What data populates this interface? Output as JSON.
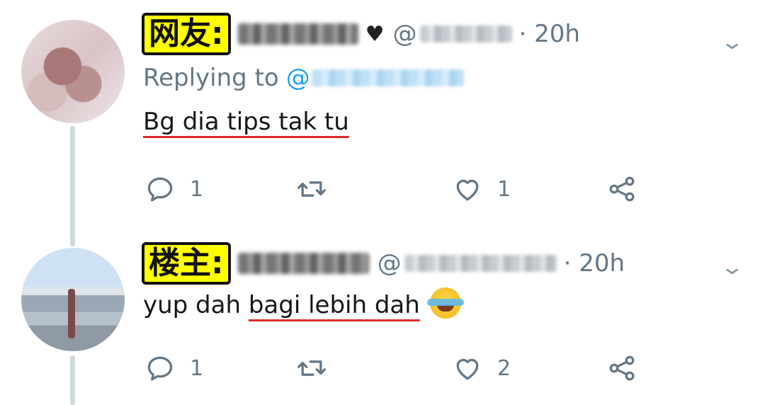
{
  "tweets": [
    {
      "tag": "网友:",
      "handle_prefix": "@",
      "time": "20h",
      "replying_label": "Replying to",
      "replying_at": "@",
      "text": "Bg dia tips tak tu",
      "reply_count": "1",
      "retweet_count": "",
      "like_count": "1"
    },
    {
      "tag": "楼主:",
      "handle_prefix": "@",
      "time": "20h",
      "text_plain": "yup dah ",
      "text_underlined": "bagi lebih dah",
      "reply_count": "1",
      "retweet_count": "",
      "like_count": "2"
    }
  ],
  "icons": [
    "reply-icon",
    "retweet-icon",
    "like-icon",
    "share-icon",
    "chevron-down-icon",
    "crying-laughing-emoji"
  ],
  "colors": {
    "handle_gray": "#657786",
    "link_blue": "#1da1f2",
    "underline_red": "#e22a2a",
    "tag_yellow": "#ffff00"
  }
}
